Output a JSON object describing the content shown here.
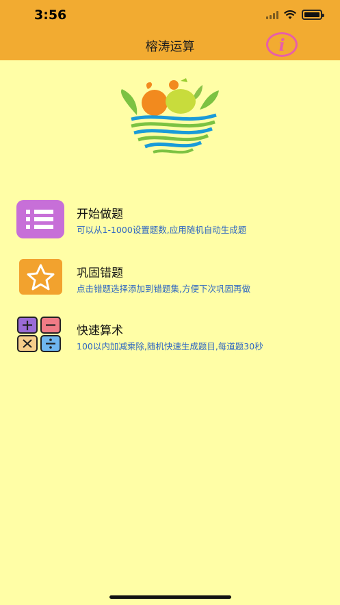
{
  "status_bar": {
    "time": "3:56"
  },
  "nav": {
    "title": "榕涛运算",
    "info_label": "i"
  },
  "menu": [
    {
      "title": "开始做题",
      "desc": "可以从1-1000设置题数,应用随机自动生成题",
      "icon": "list-icon"
    },
    {
      "title": "巩固错题",
      "desc": "点击错题选择添加到错题集,方便下次巩固再做",
      "icon": "star-icon"
    },
    {
      "title": "快速算术",
      "desc": "100以内加减乘除,随机快速生成题目,每道题30秒",
      "icon": "arithmetic-icon"
    }
  ],
  "colors": {
    "header": "#f2ab31",
    "background": "#fffea6",
    "desc_text": "#2f67c2",
    "info": "#e85fa8"
  }
}
